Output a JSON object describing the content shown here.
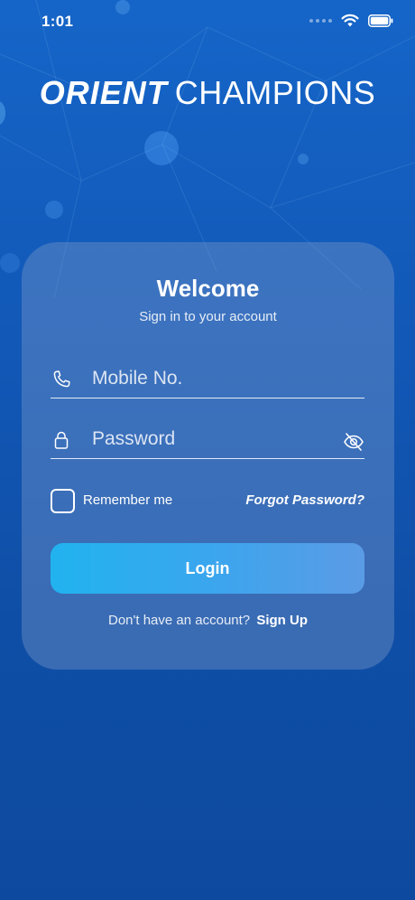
{
  "status_bar": {
    "time": "1:01",
    "icons": [
      "signal-dots-icon",
      "wifi-icon",
      "battery-icon"
    ]
  },
  "brand": {
    "part1": "ORIENT",
    "part2": "CHAMPIONS"
  },
  "login_card": {
    "title": "Welcome",
    "subtitle": "Sign in to your account",
    "mobile_field": {
      "placeholder": "Mobile No.",
      "value": "",
      "icon": "phone-icon"
    },
    "password_field": {
      "placeholder": "Password",
      "value": "",
      "icon": "lock-icon",
      "toggle_icon": "eye-slash-icon"
    },
    "remember_label": "Remember me",
    "remember_checked": false,
    "forgot_label": "Forgot Password?",
    "login_label": "Login",
    "signup_prompt": "Don't have an account?",
    "signup_label": "Sign Up"
  },
  "colors": {
    "background_top": "#1565c8",
    "background_bottom": "#0d4a9f",
    "button_start": "#21b3ef",
    "button_end": "#5b9be5"
  }
}
